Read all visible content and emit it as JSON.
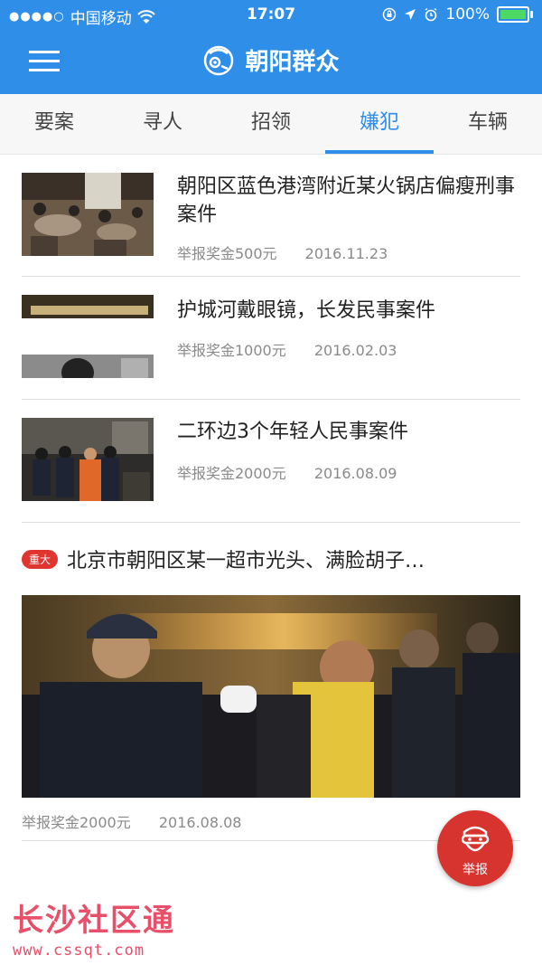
{
  "status_bar": {
    "signal_dots": "●●●●○",
    "carrier": "中国移动",
    "time": "17:07",
    "battery_percent": "100%"
  },
  "header": {
    "title": "朝阳群众",
    "brand_color": "#2f8ee8"
  },
  "tabs": [
    {
      "label": "要案",
      "active": false
    },
    {
      "label": "寻人",
      "active": false
    },
    {
      "label": "招领",
      "active": false
    },
    {
      "label": "嫌犯",
      "active": true
    },
    {
      "label": "车辆",
      "active": false
    }
  ],
  "items": [
    {
      "title": "朝阳区蓝色港湾附近某火锅店偏瘦刑事案件",
      "reward": "举报奖金500元",
      "date": "2016.11.23"
    },
    {
      "title": "护城河戴眼镜，长发民事案件",
      "reward": "举报奖金1000元",
      "date": "2016.02.03"
    },
    {
      "title": "二环边3个年轻人民事案件",
      "reward": "举报奖金2000元",
      "date": "2016.08.09"
    }
  ],
  "featured": {
    "badge": "重大",
    "title": "北京市朝阳区某一超市光头、满脸胡子…",
    "reward": "举报奖金2000元",
    "date": "2016.08.08"
  },
  "fab": {
    "label": "举报",
    "icon": "masked-face-icon",
    "color": "#d8342f"
  },
  "watermark": {
    "main": "长沙社区通",
    "url": "www.cssqt.com"
  }
}
